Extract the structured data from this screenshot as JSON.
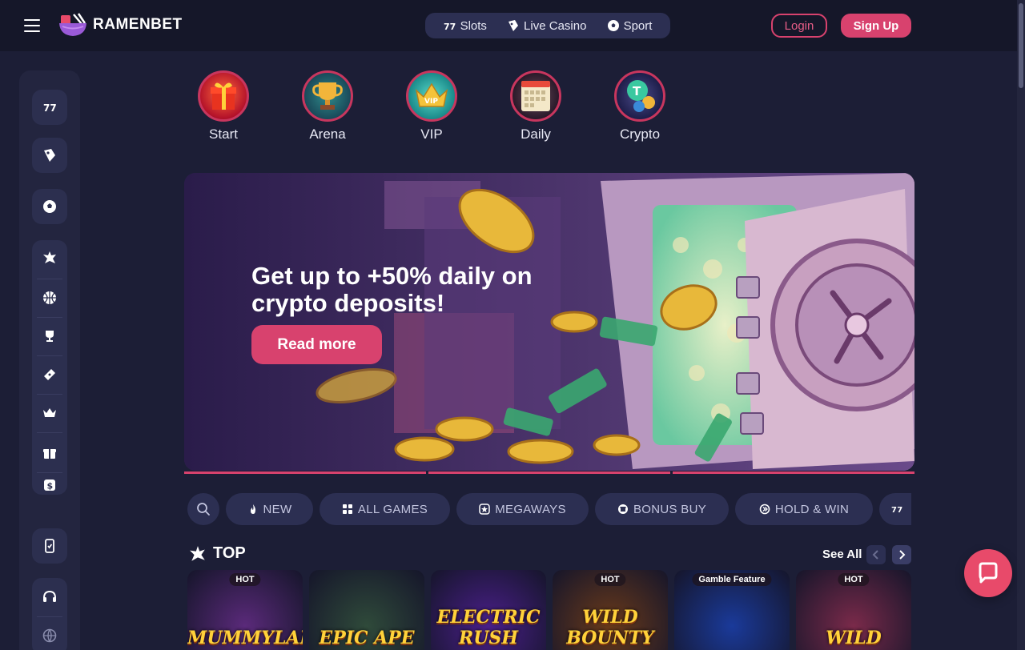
{
  "brand": {
    "name": "RAMENBET"
  },
  "topnav": [
    {
      "label": "Slots",
      "icon": "slots-icon"
    },
    {
      "label": "Live Casino",
      "icon": "live-casino-icon"
    },
    {
      "label": "Sport",
      "icon": "soccer-ball-icon"
    }
  ],
  "auth": {
    "login": "Login",
    "signup": "Sign Up"
  },
  "quick_categories": [
    {
      "label": "Start",
      "icon": "gift-box-icon"
    },
    {
      "label": "Arena",
      "icon": "trophy-icon"
    },
    {
      "label": "VIP",
      "icon": "vip-crown-icon"
    },
    {
      "label": "Daily",
      "icon": "calendar-icon"
    },
    {
      "label": "Crypto",
      "icon": "crypto-coins-icon"
    }
  ],
  "banner": {
    "title": "Get up to +50% daily on crypto deposits!",
    "cta": "Read more",
    "slides": 3,
    "active_slide": 1
  },
  "filters": [
    {
      "label": "NEW",
      "icon": "fire-icon"
    },
    {
      "label": "ALL GAMES",
      "icon": "grid-icon"
    },
    {
      "label": "MEGAWAYS",
      "icon": "star-badge-icon"
    },
    {
      "label": "BONUS BUY",
      "icon": "bonus-icon"
    },
    {
      "label": "HOLD & WIN",
      "icon": "hold-win-icon"
    }
  ],
  "top_section": {
    "title": "TOP",
    "see_all": "See All",
    "games": [
      {
        "badge": "HOT",
        "title": "MUMMYLAND",
        "bg": "#5a2a7a"
      },
      {
        "badge": "",
        "title": "EPIC APE",
        "bg": "#2f4a3a"
      },
      {
        "badge": "",
        "title": "ELECTRIC RUSH",
        "bg": "#4a1f8a"
      },
      {
        "badge": "HOT",
        "title": "WILD BOUNTY",
        "bg": "#6a3a1a"
      },
      {
        "badge": "Gamble Feature",
        "title": "",
        "bg": "#1a3a9a"
      },
      {
        "badge": "HOT",
        "title": "WILD",
        "bg": "#7a2a4a"
      }
    ]
  },
  "colors": {
    "accent": "#d8426e",
    "background": "#1c1e36",
    "header": "#151729",
    "chat": "#e84a6a"
  }
}
